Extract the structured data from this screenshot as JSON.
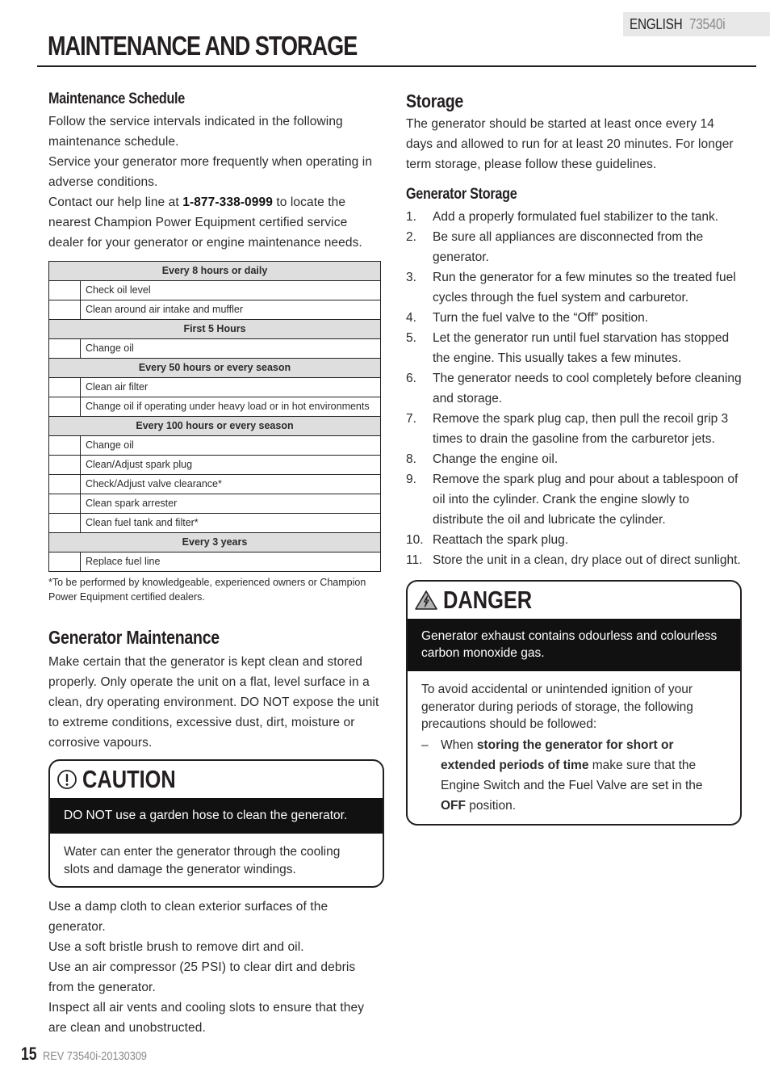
{
  "header": {
    "language": "ENGLISH",
    "model": "73540i",
    "title": "MAINTENANCE AND STORAGE"
  },
  "maintenance_schedule": {
    "heading": "Maintenance Schedule",
    "intro_1": "Follow the service intervals indicated in the following maintenance schedule.",
    "intro_2": "Service your generator more frequently when operating in adverse conditions.",
    "intro_3_before": "Contact our help line at ",
    "phone": "1-877-338-0999",
    "intro_3_after": " to locate the nearest Champion Power Equipment certified service dealer for your generator or engine maintenance needs.",
    "groups": [
      {
        "interval": "Every 8 hours or daily",
        "tasks": [
          "Check oil level",
          "Clean around air intake and muffler"
        ]
      },
      {
        "interval": "First 5 Hours",
        "tasks": [
          "Change oil"
        ]
      },
      {
        "interval": "Every 50 hours or every season",
        "tasks": [
          "Clean air filter",
          "Change oil if operating under heavy load or in hot environments"
        ]
      },
      {
        "interval": "Every 100 hours or every season",
        "tasks": [
          "Change oil",
          "Clean/Adjust spark plug",
          "Check/Adjust valve clearance*",
          "Clean spark arrester",
          "Clean fuel tank and filter*"
        ]
      },
      {
        "interval": "Every 3 years",
        "tasks": [
          "Replace fuel line"
        ]
      }
    ],
    "footnote": "*To be performed by knowledgeable, experienced owners or Champion Power Equipment certified dealers."
  },
  "generator_maintenance": {
    "heading": "Generator Maintenance",
    "body": "Make certain that the generator is kept clean and stored properly. Only operate the unit on a flat, level surface in a clean, dry operating environment. DO NOT expose the unit to extreme conditions, excessive dust, dirt, moisture or corrosive vapours.",
    "caution": {
      "icon": "exclamation-circle-icon",
      "label": "CAUTION",
      "bar_text": "DO NOT use a garden hose to clean the generator.",
      "body": "Water can enter the generator through the cooling slots and damage the generator windings."
    },
    "tips": [
      "Use a damp cloth to clean exterior surfaces of the generator.",
      "Use a soft bristle brush to remove dirt and oil.",
      "Use an air compressor (25 PSI) to clear dirt and debris from the generator.",
      "Inspect all air vents and cooling slots to ensure that they are clean and unobstructed."
    ]
  },
  "storage": {
    "heading": "Storage",
    "intro": "The generator should be started at least once every 14 days and allowed to run for at least 20 minutes. For longer term storage, please follow these guidelines.",
    "sub_heading": "Generator Storage",
    "steps": [
      {
        "num": "1.",
        "text": "Add a properly formulated fuel stabilizer to the tank."
      },
      {
        "num": "2.",
        "text": "Be sure all appliances are disconnected from the generator."
      },
      {
        "num": "3.",
        "text": "Run the generator for a few minutes so the treated fuel cycles through the fuel system and carburetor."
      },
      {
        "num": "4.",
        "text": "Turn the fuel valve to the “Off” position."
      },
      {
        "num": "5.",
        "text": "Let the generator run until fuel starvation has stopped the engine. This usually takes a few minutes."
      },
      {
        "num": "6.",
        "text": "The generator needs to cool completely before cleaning and storage."
      },
      {
        "num": "7.",
        "text": "Remove the spark plug cap, then pull the recoil grip 3 times to drain the gasoline from the carburetor jets."
      },
      {
        "num": "8.",
        "text": "Change the engine oil."
      },
      {
        "num": "9.",
        "text": "Remove the spark plug and pour about a tablespoon of oil into the cylinder. Crank the engine slowly to distribute the oil and lubricate the cylinder."
      },
      {
        "num": "10.",
        "text": "Reattach the spark plug."
      },
      {
        "num": "11.",
        "text": "Store the unit in a clean, dry place out of direct sunlight."
      }
    ],
    "danger": {
      "icon": "electrical-hazard-triangle-icon",
      "label": "DANGER",
      "bar_text": "Generator exhaust contains odourless and colourless carbon monoxide gas.",
      "body": "To avoid accidental or unintended ignition of your generator during periods of storage, the following precautions should be followed:",
      "bullet_dash": "–",
      "bullet_1": "When ",
      "bullet_bold_1": "storing the generator for short or extended periods of time",
      "bullet_2": " make sure that the Engine Switch and the Fuel Valve are set in the ",
      "bullet_bold_2": "OFF",
      "bullet_3": " position."
    }
  },
  "footer": {
    "page_number": "15",
    "revision": "REV 73540i-20130309"
  }
}
